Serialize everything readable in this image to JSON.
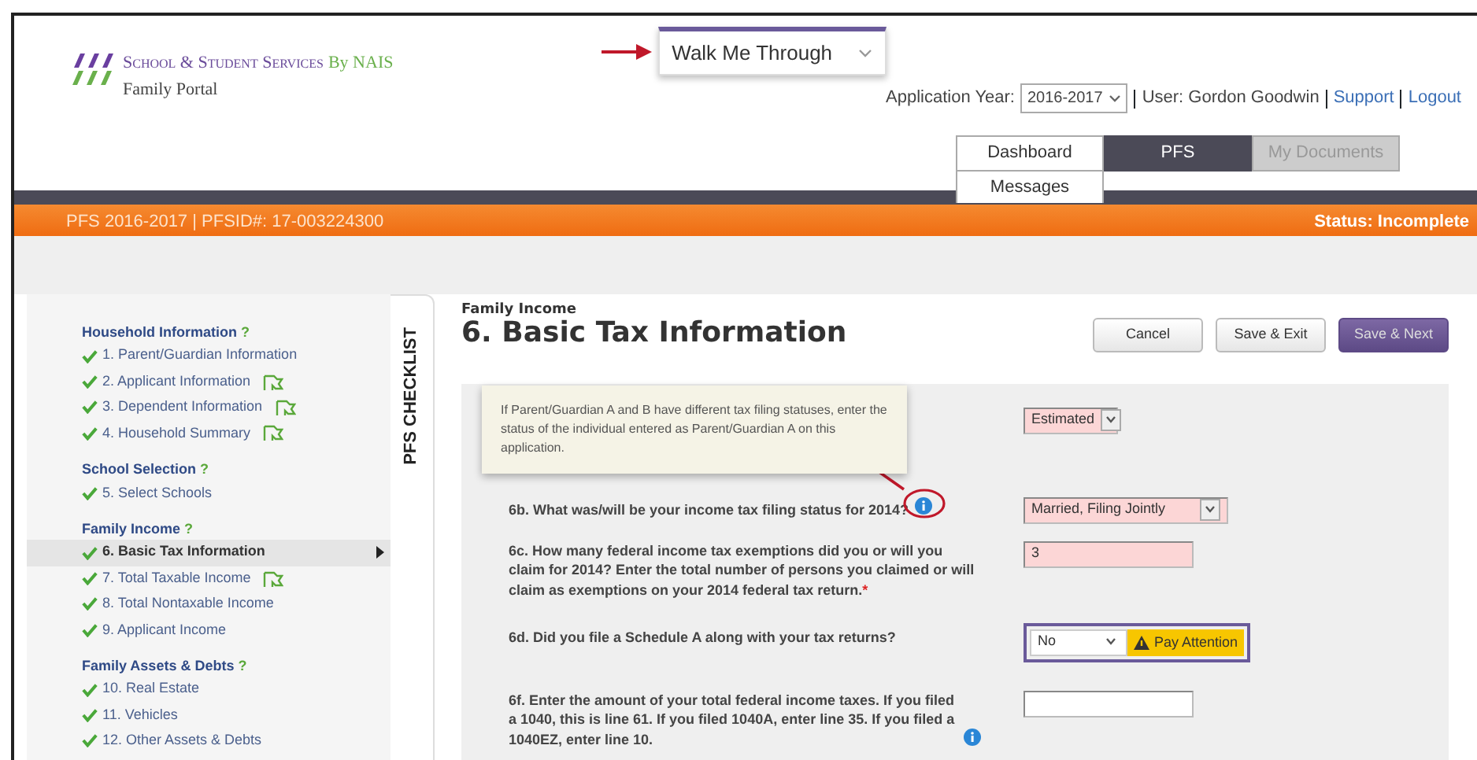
{
  "header": {
    "brand": "School & Student Services",
    "brand_suffix": "By NAIS",
    "subtitle": "Family Portal"
  },
  "walkthrough": {
    "label": "Walk Me Through"
  },
  "account": {
    "year_label": "Application Year:",
    "year": "2016-2017",
    "user": "User: Gordon Goodwin",
    "links": [
      "Support",
      "Logout"
    ]
  },
  "nav_tabs": [
    {
      "label": "Dashboard",
      "selected": false,
      "disabled": false
    },
    {
      "label": "PFS",
      "selected": true,
      "disabled": false
    },
    {
      "label": "My Documents",
      "selected": false,
      "disabled": true
    },
    {
      "label": "Messages",
      "selected": false,
      "disabled": false
    }
  ],
  "banner": {
    "title": "PFS 2016-2017 | PFSID#: 17-003224300",
    "status": "Status: Incomplete"
  },
  "checklist": {
    "tab_label": "PFS CHECKLIST",
    "sections": [
      {
        "title": "Household Information",
        "help": "?",
        "items": [
          {
            "label": "1. Parent/Guardian Information",
            "done": true,
            "selected": false,
            "flagged": false
          },
          {
            "label": "2. Applicant Information",
            "done": true,
            "selected": false,
            "flagged": true
          },
          {
            "label": "3. Dependent Information",
            "done": true,
            "selected": false,
            "flagged": true
          },
          {
            "label": "4. Household Summary",
            "done": true,
            "selected": false,
            "flagged": true
          }
        ]
      },
      {
        "title": "School Selection",
        "help": "?",
        "items": [
          {
            "label": "5. Select Schools",
            "done": true,
            "selected": false,
            "flagged": false
          }
        ]
      },
      {
        "title": "Family Income",
        "help": "?",
        "items": [
          {
            "label": "6. Basic Tax Information",
            "done": true,
            "selected": true,
            "flagged": false
          },
          {
            "label": "7. Total Taxable Income",
            "done": true,
            "selected": false,
            "flagged": true
          },
          {
            "label": "8. Total Nontaxable Income",
            "done": true,
            "selected": false,
            "flagged": false
          },
          {
            "label": "9. Applicant Income",
            "done": true,
            "selected": false,
            "flagged": false
          }
        ]
      },
      {
        "title": "Family Assets & Debts",
        "help": "?",
        "items": [
          {
            "label": "10. Real Estate",
            "done": true,
            "selected": false,
            "flagged": false
          },
          {
            "label": "11. Vehicles",
            "done": true,
            "selected": false,
            "flagged": false
          },
          {
            "label": "12. Other Assets & Debts",
            "done": true,
            "selected": false,
            "flagged": false
          }
        ]
      }
    ]
  },
  "page": {
    "section": "Family Income",
    "title": "6. Basic Tax Information",
    "buttons": [
      {
        "label": "Cancel",
        "kind": "secondary"
      },
      {
        "label": "Save & Exit",
        "kind": "secondary"
      },
      {
        "label": "Save & Next",
        "kind": "primary"
      }
    ]
  },
  "tooltip": {
    "text": "If Parent/Guardian A and B have different tax filing statuses, enter the status of the individual entered as Parent/Guardian A on this application."
  },
  "questions": [
    {
      "kind": "select",
      "value": "Estimated",
      "invalid": true
    },
    {
      "kind": "select",
      "label": "6b. What was/will be your income tax filing status for 2014?",
      "value": "Married, Filing Jointly",
      "invalid": true,
      "info": true,
      "highlighted": true
    },
    {
      "kind": "input",
      "label": "6c. How many federal income tax exemptions did you or will you claim for 2014? Enter the total number of persons you claimed or will claim as exemptions on your 2014 federal tax return.",
      "required_mark": "*",
      "value": "3",
      "invalid": true,
      "info": false
    },
    {
      "kind": "select",
      "label": "6d. Did you file a Schedule A along with your tax returns?",
      "value": "No",
      "invalid": false,
      "info": false,
      "warning": "Pay Attention"
    },
    {
      "kind": "input",
      "label": "6f. Enter the amount of your total federal income taxes. If you filed a 1040, this is line 61. If you filed 1040A, enter line 35. If you filed a 1040EZ, enter line 10.",
      "invalid": false,
      "info": true
    }
  ]
}
